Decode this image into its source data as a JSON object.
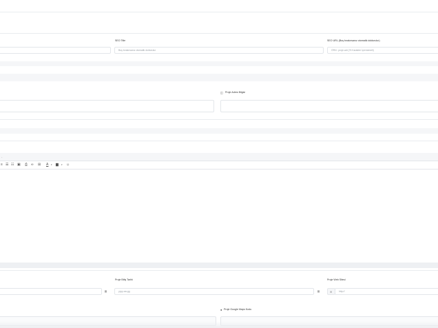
{
  "seo": {
    "title_label": "SEO Title",
    "title_placeholder": "Boş bırakırsanız otomatik doldurulur",
    "url_label": "SEO URL (Boş bırakırsanız otomatik doldurulur)",
    "url_placeholder": "ÖRN : proje-adi (76 Karakter İçermemeli)"
  },
  "address": {
    "label": "Proje Adres Bilgisi",
    "icon": "map-icon"
  },
  "editor": {
    "dropdown_marker": "-",
    "toolbar_icons": [
      "align-icon",
      "list-ordered-icon",
      "list-unordered-icon",
      "image-icon",
      "print-icon",
      "link-icon",
      "table-icon",
      "font-color-icon",
      "background-color-icon",
      "special-char-icon"
    ],
    "toolbar_glyphs": [
      "≡",
      "☰",
      "☷",
      "▣",
      "⎙",
      "∞",
      "⊞",
      "A",
      "▆",
      "☺"
    ]
  },
  "dates": {
    "end_label": "Proje Bitiş Tarihi",
    "end_placeholder": "yyyy-aa-gg"
  },
  "website": {
    "label": "Proje Web Sitesi",
    "placeholder": "http://"
  },
  "maps": {
    "label": "Proje Google Maps Kodu"
  }
}
